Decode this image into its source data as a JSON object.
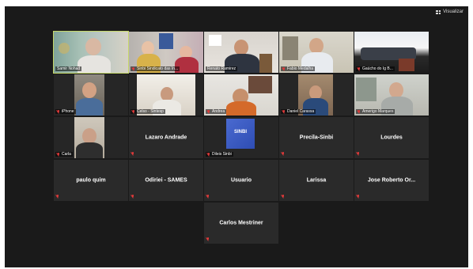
{
  "toolbar": {
    "view_label": "Visualizar"
  },
  "participants": [
    {
      "name": "Samir Nohad",
      "video": true
    },
    {
      "name": "Sinbi Sindicato das In...",
      "video": true
    },
    {
      "name": "Renato Ramirez",
      "video": true
    },
    {
      "name": "Fabio Medalha",
      "video": true
    },
    {
      "name": "Gaúcho do Ig B...",
      "video": true
    },
    {
      "name": "iPhone",
      "video": true
    },
    {
      "name": "Celso - Sintesp",
      "video": true
    },
    {
      "name": "Andrea",
      "video": true
    },
    {
      "name": "Daniel Carassa",
      "video": true
    },
    {
      "name": "Amerigo Marques",
      "video": true
    },
    {
      "name": "Carla",
      "video": true
    },
    {
      "name": "Lazaro Andrade",
      "video": false
    },
    {
      "name": "Dileis Sinbi",
      "video": true
    },
    {
      "name": "Precila-Sinbi",
      "video": false
    },
    {
      "name": "Lourdes",
      "video": false
    },
    {
      "name": "paulo quim",
      "video": false
    },
    {
      "name": "Odiriei - SAMES",
      "video": false
    },
    {
      "name": "Usuario",
      "video": false
    },
    {
      "name": "Larissa",
      "video": false
    },
    {
      "name": "Jose Roberto Or...",
      "video": false
    },
    {
      "name": "Carlos Mestriner",
      "video": false
    }
  ],
  "logo_text": "SINBI",
  "colors": {
    "speaking_outline": "#c6d86a",
    "muted": "#e23a3a",
    "tile_bg": "#2a2a2a"
  }
}
